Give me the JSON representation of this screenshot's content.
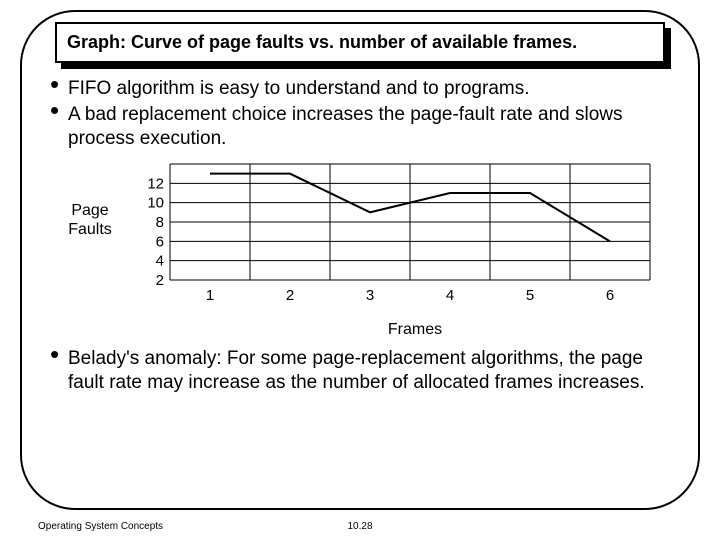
{
  "title": "Graph: Curve of page faults vs. number of available frames.",
  "bullets_top": [
    "FIFO algorithm is easy to understand and to programs.",
    "A bad replacement choice increases the page-fault rate and slows process execution."
  ],
  "bullets_bottom": [
    "Belady's anomaly: For some page-replacement algorithms, the page fault rate may increase as the number of allocated frames increases."
  ],
  "chart_data": {
    "type": "line",
    "title": "",
    "xlabel": "Frames",
    "ylabel": "Page\nFaults",
    "categories": [
      1,
      2,
      3,
      4,
      5,
      6
    ],
    "values": [
      13,
      13,
      9,
      11,
      11,
      6
    ],
    "x_ticks": [
      1,
      2,
      3,
      4,
      5,
      6
    ],
    "y_ticks": [
      2,
      4,
      6,
      8,
      10,
      12
    ],
    "xlim": [
      1,
      6
    ],
    "ylim": [
      2,
      14
    ]
  },
  "footer": {
    "left": "Operating System Concepts",
    "center": "10.28"
  }
}
